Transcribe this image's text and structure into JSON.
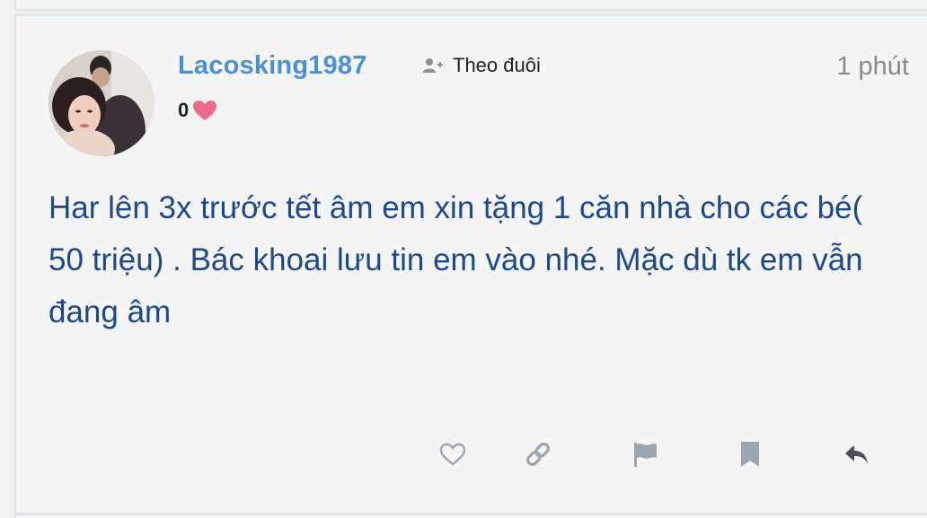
{
  "post": {
    "author": "Lacosking1987",
    "follow_label": "Theo đuôi",
    "time": "1 phút",
    "reputation": "0",
    "content": "Har lên 3x trước tết âm em xin tặng 1 căn nhà cho các bé( 50 triệu) . Bác khoai lưu tin em vào nhé. Mặc dù tk em vẫn đang âm"
  },
  "icons": {
    "follow": "user-plus-icon",
    "reputation": "heart-icon",
    "like": "heart-outline-icon",
    "link": "link-icon",
    "report": "flag-icon",
    "bookmark": "bookmark-icon",
    "reply": "reply-icon"
  },
  "colors": {
    "author": "#4a90d9",
    "content": "#1a4a8a",
    "heart": "#f06a8a",
    "time": "#8a8a8a",
    "action_icons": "#9ba6b4"
  }
}
